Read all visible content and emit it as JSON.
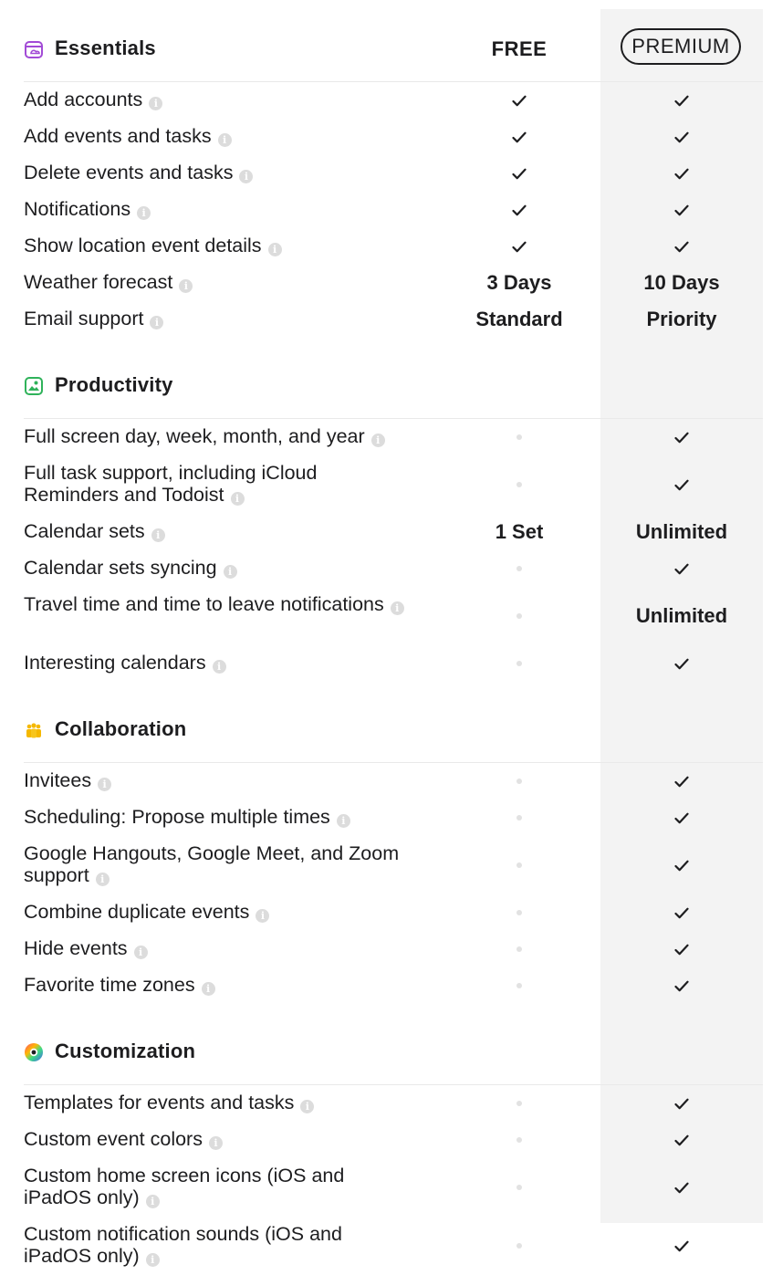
{
  "header": {
    "free_label": "FREE",
    "premium_label": "PREMIUM"
  },
  "colors": {
    "premium_column_bg": "#f3f3f3",
    "essentials_icon": "#a24bd6",
    "productivity_icon": "#2fb25a",
    "collaboration_icon": "#f5b800",
    "text": "#1d1d1f"
  },
  "sections": [
    {
      "title": "Essentials",
      "icon": "calendar-icon",
      "rows": [
        {
          "label": "Add accounts",
          "free": "check",
          "premium": "check"
        },
        {
          "label": "Add events and tasks",
          "free": "check",
          "premium": "check"
        },
        {
          "label": "Delete events and tasks",
          "free": "check",
          "premium": "check"
        },
        {
          "label": "Notifications",
          "free": "check",
          "premium": "check"
        },
        {
          "label": "Show location event details",
          "free": "check",
          "premium": "check"
        },
        {
          "label": "Weather forecast",
          "free": "3 Days",
          "premium": "10 Days"
        },
        {
          "label": "Email support",
          "free": "Standard",
          "premium": "Priority"
        }
      ]
    },
    {
      "title": "Productivity",
      "icon": "productivity-icon",
      "rows": [
        {
          "label": "Full screen day, week, month, and year",
          "free": "none",
          "premium": "check"
        },
        {
          "label": "Full task support, including iCloud Reminders and Todoist",
          "free": "none",
          "premium": "check"
        },
        {
          "label": "Calendar sets",
          "free": "1 Set",
          "premium": "Unlimited"
        },
        {
          "label": "Calendar sets syncing",
          "free": "none",
          "premium": "check"
        },
        {
          "label": "Travel time and time to leave notifications",
          "free": "none",
          "premium": "Unlimited"
        },
        {
          "label": "Interesting calendars",
          "free": "none",
          "premium": "check"
        }
      ]
    },
    {
      "title": "Collaboration",
      "icon": "people-icon",
      "rows": [
        {
          "label": "Invitees",
          "free": "none",
          "premium": "check"
        },
        {
          "label": "Scheduling: Propose multiple times",
          "free": "none",
          "premium": "check"
        },
        {
          "label": "Google Hangouts, Google Meet, and Zoom support",
          "free": "none",
          "premium": "check"
        },
        {
          "label": "Combine duplicate events",
          "free": "none",
          "premium": "check"
        },
        {
          "label": "Hide events",
          "free": "none",
          "premium": "check"
        },
        {
          "label": "Favorite time zones",
          "free": "none",
          "premium": "check"
        }
      ]
    },
    {
      "title": "Customization",
      "icon": "color-wheel-icon",
      "rows": [
        {
          "label": "Templates for events and tasks",
          "free": "none",
          "premium": "check"
        },
        {
          "label": "Custom event colors",
          "free": "none",
          "premium": "check"
        },
        {
          "label": "Custom home screen icons (iOS and iPadOS only)",
          "free": "none",
          "premium": "check"
        },
        {
          "label": "Custom notification sounds (iOS and iPadOS only)",
          "free": "none",
          "premium": "check"
        }
      ]
    }
  ]
}
